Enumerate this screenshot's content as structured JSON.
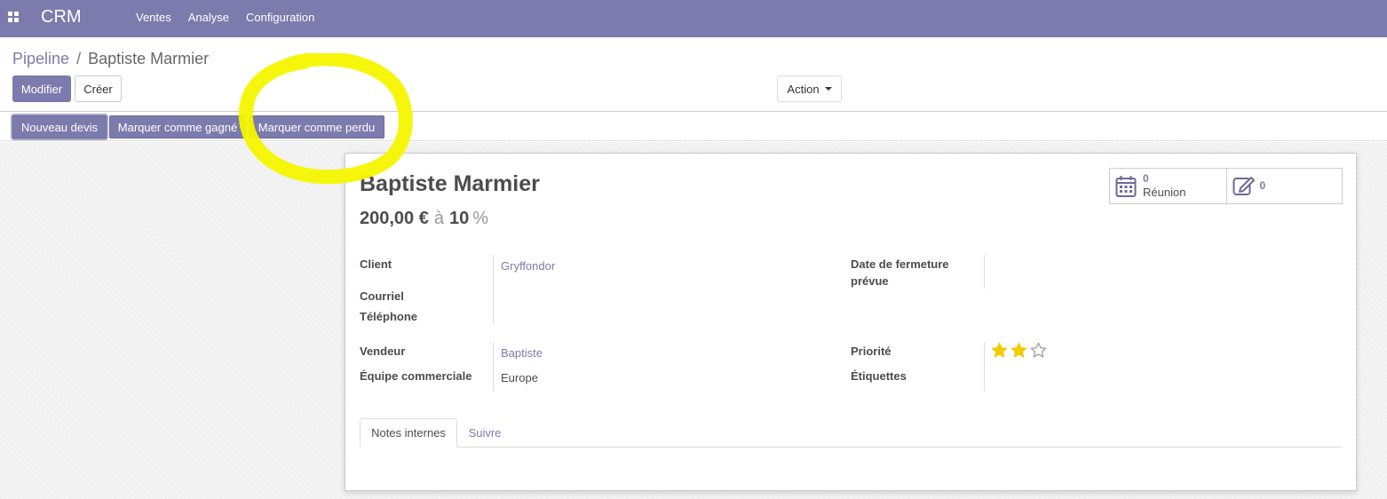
{
  "navbar": {
    "app_name": "CRM",
    "menu": [
      "Ventes",
      "Analyse",
      "Configuration"
    ]
  },
  "breadcrumb": {
    "parent": "Pipeline",
    "separator": "/",
    "current": "Baptiste Marmier"
  },
  "control_panel": {
    "edit_label": "Modifier",
    "create_label": "Créer",
    "action_label": "Action"
  },
  "status_bar": {
    "buttons": [
      "Nouveau devis",
      "Marquer comme gagné",
      "Marquer comme perdu"
    ]
  },
  "form": {
    "title": "Baptiste Marmier",
    "revenue": "200,00 €",
    "at_label": "à",
    "probability": "10",
    "percent_sign": "%",
    "smart_buttons": {
      "meetings_count": "0",
      "meetings_label": "Réunion",
      "notes_count": "0"
    },
    "fields": {
      "client_label": "Client",
      "client_value": "Gryffondor",
      "email_label": "Courriel",
      "phone_label": "Téléphone",
      "closing_label_line1": "Date de fermeture",
      "closing_label_line2": "prévue",
      "salesperson_label": "Vendeur",
      "salesperson_value": "Baptiste",
      "team_label": "Équipe commerciale",
      "team_value": "Europe",
      "priority_label": "Priorité",
      "priority_value": 2,
      "priority_max": 3,
      "tags_label": "Étiquettes"
    },
    "tabs": [
      "Notes internes",
      "Suivre"
    ]
  },
  "colors": {
    "brand": "#7c7bad",
    "star_filled": "#f3cc00",
    "annotation": "#f5f500"
  }
}
